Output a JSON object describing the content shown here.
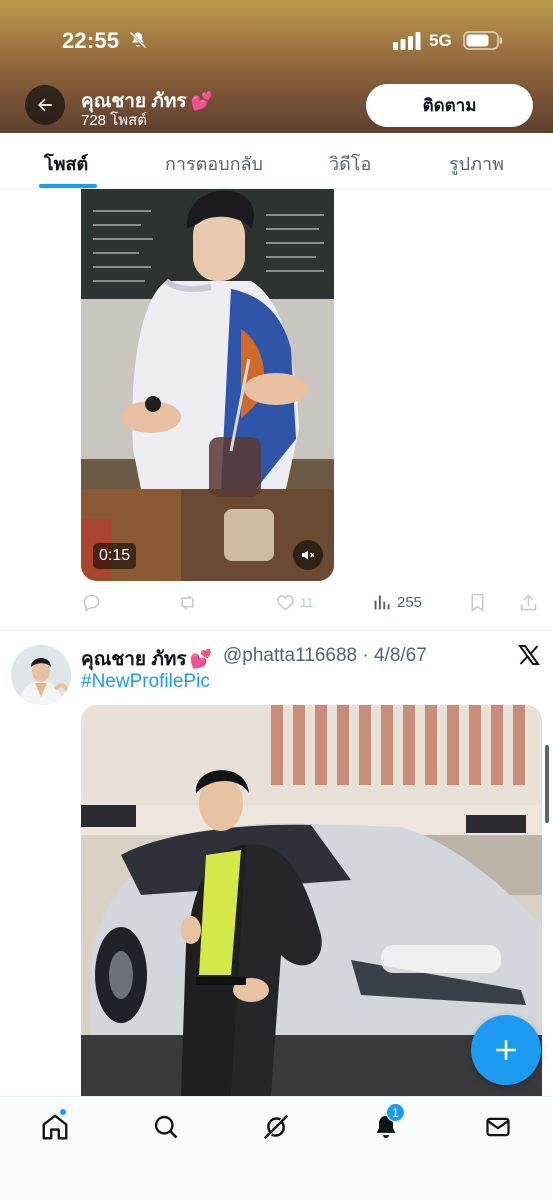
{
  "status_bar": {
    "time": "22:55",
    "network": "5G"
  },
  "profile": {
    "name": "คุณชาย ภัทร",
    "name_emoji": "💕",
    "post_count": "728 โพสต์",
    "follow_label": "ติดตาม"
  },
  "tabs": [
    {
      "label": "โพสต์",
      "active": true
    },
    {
      "label": "การตอบกลับ",
      "active": false
    },
    {
      "label": "วิดีโอ",
      "active": false
    },
    {
      "label": "รูปภาพ",
      "active": false
    }
  ],
  "post1": {
    "video_duration": "0:15",
    "actions": {
      "like_count": "11",
      "views": "255"
    }
  },
  "post2": {
    "author_name": "คุณชาย ภัทร",
    "author_emoji": "💕",
    "handle_date": "@phatta116688 · 4/8/67",
    "hashtag": "#NewProfilePic"
  },
  "bottom_nav": {
    "notifications_badge": "1"
  },
  "colors": {
    "accent": "#1d9bf0",
    "text": "#0f1419",
    "muted": "#536471"
  }
}
